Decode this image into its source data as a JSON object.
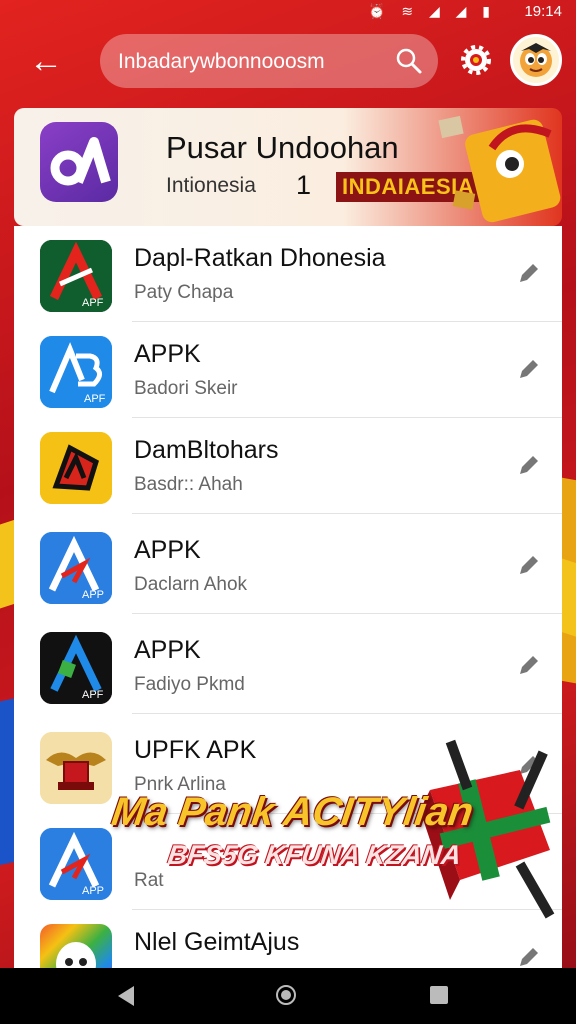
{
  "status_bar": {
    "time": "19:14",
    "icons": "⏰ ≋ ◢ ◢ ▮"
  },
  "search": {
    "text": "Inbadarywbonnooosm"
  },
  "hero": {
    "title": "Pusar Undoohan",
    "subtitle": "Intionesia",
    "number": "1",
    "badge": "INDAIAESIA"
  },
  "apps": [
    {
      "name": "Dapl-Ratkan Dhonesia",
      "sub": "Paty Chapa",
      "icon_label": "APF"
    },
    {
      "name": "APPK",
      "sub": "Badori Skeir",
      "icon_label": "APF"
    },
    {
      "name": "DamBltohars",
      "sub": "Basdr:: Ahah",
      "icon_label": ""
    },
    {
      "name": "APPK",
      "sub": "Daclarn Ahok",
      "icon_label": "APP"
    },
    {
      "name": "APPK",
      "sub": "Fadiyo Pkmd",
      "icon_label": "APF"
    },
    {
      "name": "UPFK APK",
      "sub": "Pnrk Arlina",
      "icon_label": ""
    },
    {
      "name": "",
      "sub": "Rat",
      "icon_label": "APP"
    },
    {
      "name": "Nlel GeimtAjus",
      "sub": "",
      "icon_label": ""
    }
  ],
  "promo": {
    "line1": "Ma Pank ACITYlian",
    "line2": "BFS5G KFUNA KZANA"
  },
  "colors": {
    "accent": "#d8191e",
    "badge": "#f7c21a",
    "icon_blue": "#1f8ae8",
    "icon_yellow": "#f5c114"
  }
}
